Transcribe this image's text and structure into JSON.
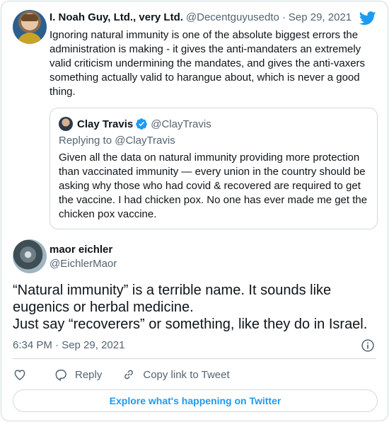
{
  "parent_tweet": {
    "author_name": "I. Noah Guy, Ltd., very Ltd.",
    "handle": "@Decentguyusedto",
    "separator": "·",
    "date": "Sep 29, 2021",
    "text": "Ignoring natural immunity is one of the absolute biggest errors the administration is making - it gives the anti-mandaters an extremely valid criticism undermining the mandates, and gives the anti-vaxers something actually valid to harangue about, which is never a good thing."
  },
  "quoted_tweet": {
    "author_name": "Clay Travis",
    "handle": "@ClayTravis",
    "replying_to_prefix": "Replying to ",
    "replying_to_handle": "@ClayTravis",
    "text": "Given all the data on natural immunity providing more protection than vaccinated immunity — every union in the country should be asking why those who had covid & recovered are required to get the vaccine. I had chicken pox. No one has ever made me get the chicken pox vaccine."
  },
  "main_tweet": {
    "author_name": "maor eichler",
    "handle": "@EichlerMaor",
    "text": "“Natural immunity” is a terrible name. It sounds like eugenics or herbal medicine.\nJust say “recoverers” or something, like they do in Israel.",
    "timestamp": "6:34 PM · Sep 29, 2021"
  },
  "actions": {
    "reply_label": "Reply",
    "copy_link_label": "Copy link to Tweet"
  },
  "explore_button_label": "Explore what's happening on Twitter",
  "colors": {
    "accent": "#1d9bf0",
    "text": "#0f1419",
    "muted": "#536471",
    "border": "#cfd9de"
  },
  "icons": [
    "twitter-bird-icon",
    "verified-badge-icon",
    "info-icon",
    "heart-icon",
    "reply-icon",
    "link-icon"
  ]
}
